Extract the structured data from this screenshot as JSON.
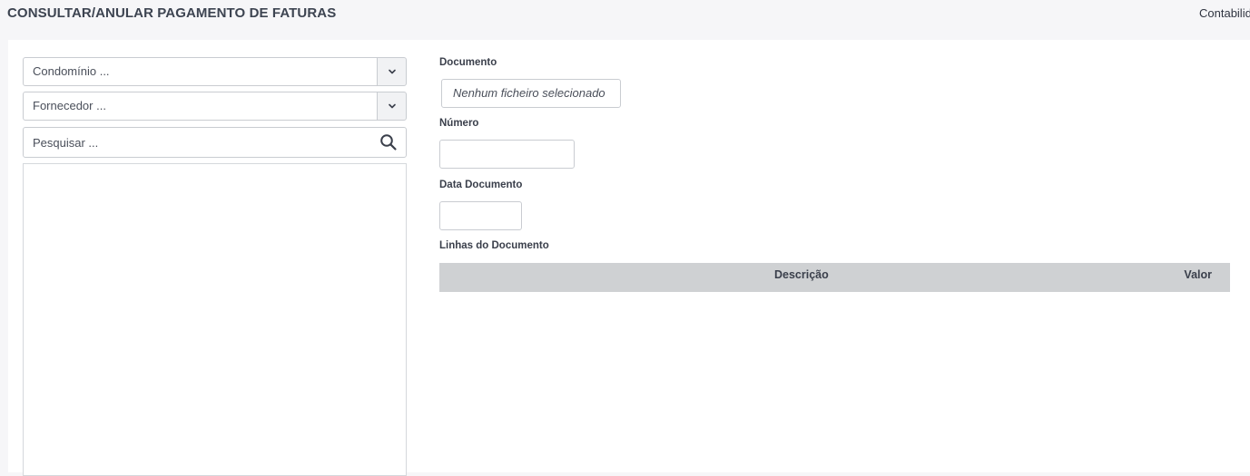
{
  "header": {
    "title": "CONSULTAR/ANULAR PAGAMENTO DE FATURAS",
    "right_link": "Contabilid"
  },
  "filters": {
    "condominio_placeholder": "Condomínio ...",
    "fornecedor_placeholder": "Fornecedor ...",
    "search_placeholder": "Pesquisar ..."
  },
  "form": {
    "documento_label": "Documento",
    "file_status": "Nenhum ficheiro selecionado",
    "numero_label": "Número",
    "numero_value": "",
    "data_label": "Data Documento",
    "data_value": "",
    "linhas_label": "Linhas do Documento",
    "columns": [
      "Descrição",
      "Valor"
    ]
  },
  "icons": {
    "dropdown": "chevron-down-icon",
    "search": "search-icon"
  }
}
